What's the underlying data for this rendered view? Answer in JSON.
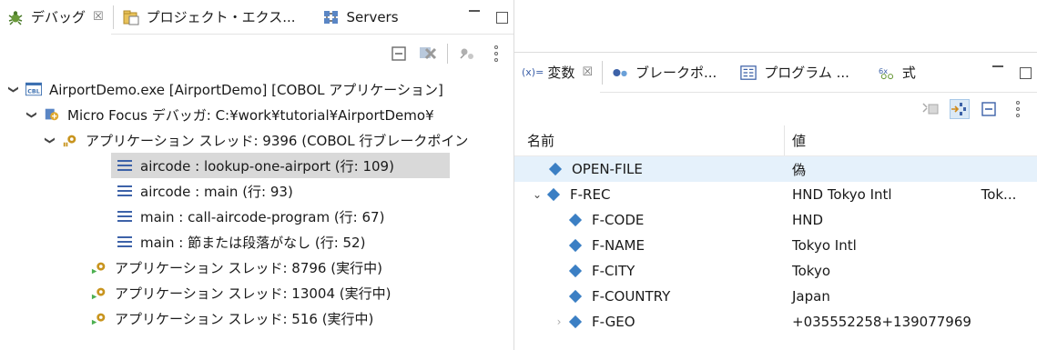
{
  "debug_view": {
    "tabs": [
      {
        "label": "デバッグ",
        "close": "☒",
        "active": true
      },
      {
        "label": "プロジェクト・エクス...",
        "active": false
      },
      {
        "label": "Servers",
        "active": false
      }
    ],
    "tree": [
      {
        "text": "AirportDemo.exe [AirportDemo] [COBOL アプリケーション]",
        "level": 0,
        "expanded": true,
        "icon": "cobol-launch-icon"
      },
      {
        "text": "Micro Focus デバッガ: C:¥work¥tutorial¥AirportDemo¥",
        "level": 1,
        "expanded": true,
        "icon": "debugger-icon"
      },
      {
        "text": "アプリケーション スレッド: 9396 (COBOL 行ブレークポイン",
        "level": 2,
        "expanded": true,
        "icon": "thread-suspended-icon"
      },
      {
        "text": "aircode : lookup-one-airport (行: 109)",
        "level": 3,
        "icon": "stack-frame-icon",
        "selected": true
      },
      {
        "text": "aircode : main (行: 93)",
        "level": 3,
        "icon": "stack-frame-icon"
      },
      {
        "text": "main : call-aircode-program (行: 67)",
        "level": 3,
        "icon": "stack-frame-icon"
      },
      {
        "text": "main : 節または段落がなし (行: 52)",
        "level": 3,
        "icon": "stack-frame-icon"
      },
      {
        "text": "アプリケーション スレッド: 8796 (実行中)",
        "level": 2,
        "icon": "thread-running-icon"
      },
      {
        "text": "アプリケーション スレッド: 13004 (実行中)",
        "level": 2,
        "icon": "thread-running-icon"
      },
      {
        "text": "アプリケーション スレッド: 516 (実行中)",
        "level": 2,
        "icon": "thread-running-icon"
      }
    ]
  },
  "variables_view": {
    "tabs": [
      {
        "prefix": "(x)=",
        "label": "変数",
        "close": "☒",
        "active": true
      },
      {
        "label": "ブレークポ...",
        "active": false
      },
      {
        "label": "プログラム ...",
        "active": false
      },
      {
        "label": "式",
        "active": false
      }
    ],
    "columns": {
      "name": "名前",
      "value": "値"
    },
    "rows": [
      {
        "name": "OPEN-FILE",
        "value": "偽",
        "level": 0,
        "selected": true
      },
      {
        "name": "F-REC",
        "value": "HND Tokyo Intl",
        "extra": "Tok...",
        "level": 0,
        "expanded": true
      },
      {
        "name": "F-CODE",
        "value": "HND",
        "level": 1
      },
      {
        "name": "F-NAME",
        "value": "Tokyo Intl",
        "level": 1
      },
      {
        "name": "F-CITY",
        "value": "Tokyo",
        "level": 1
      },
      {
        "name": "F-COUNTRY",
        "value": "Japan",
        "level": 1
      },
      {
        "name": "F-GEO",
        "value": "+035552258+139077969",
        "level": 1,
        "collapsed": true
      }
    ]
  },
  "colors": {
    "selection_gray": "#d9d9d9",
    "selection_blue": "#e5f1fb",
    "variable_diamond": "#3b7fc4",
    "thread_gold": "#c8941e",
    "run_green": "#4caf50"
  }
}
